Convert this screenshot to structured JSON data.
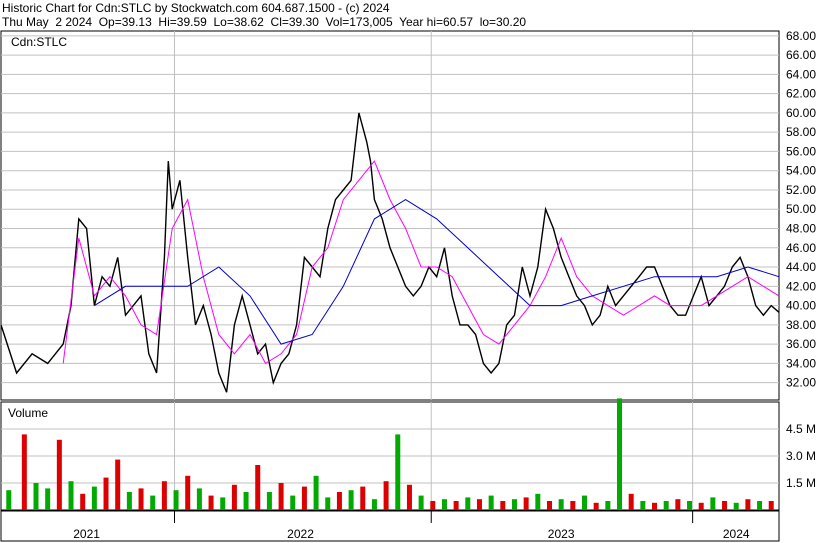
{
  "header": {
    "line1": "Historic Chart for Cdn:STLC by Stockwatch.com 604.687.1500 - (c) 2024",
    "line2": "Thu May  2 2024  Op=39.13  Hi=39.59  Lo=38.62  Cl=39.30  Vol=173,005  Year hi=60.57  lo=30.20"
  },
  "colors": {
    "price": "#000000",
    "ma_short": "#ff00ff",
    "ma_long": "#0000cc",
    "volume_up": "#00aa00",
    "volume_down": "#dd0000",
    "grid": "#c0c0c0"
  },
  "chart_data": [
    {
      "type": "line",
      "title": "Cdn:STLC",
      "ylim": [
        30.2,
        68.5
      ],
      "y_ticks": [
        "68.00",
        "66.00",
        "64.00",
        "62.00",
        "60.00",
        "58.00",
        "56.00",
        "54.00",
        "52.00",
        "50.00",
        "48.00",
        "46.00",
        "44.00",
        "42.00",
        "40.00",
        "38.00",
        "36.00",
        "34.00",
        "32.00"
      ],
      "x_labels": [
        "2021",
        "2022",
        "2023",
        "2024"
      ],
      "series": [
        {
          "role": "price",
          "x": [
            0.0,
            0.02,
            0.04,
            0.06,
            0.08,
            0.09,
            0.1,
            0.11,
            0.12,
            0.13,
            0.14,
            0.15,
            0.16,
            0.17,
            0.18,
            0.19,
            0.2,
            0.21,
            0.215,
            0.22,
            0.23,
            0.24,
            0.25,
            0.26,
            0.27,
            0.28,
            0.29,
            0.3,
            0.31,
            0.32,
            0.33,
            0.34,
            0.35,
            0.36,
            0.37,
            0.38,
            0.39,
            0.4,
            0.41,
            0.42,
            0.43,
            0.44,
            0.45,
            0.46,
            0.47,
            0.475,
            0.48,
            0.49,
            0.5,
            0.51,
            0.52,
            0.53,
            0.54,
            0.55,
            0.56,
            0.57,
            0.58,
            0.59,
            0.6,
            0.61,
            0.62,
            0.63,
            0.64,
            0.65,
            0.66,
            0.67,
            0.68,
            0.69,
            0.7,
            0.71,
            0.72,
            0.73,
            0.74,
            0.75,
            0.76,
            0.77,
            0.78,
            0.79,
            0.8,
            0.81,
            0.82,
            0.83,
            0.84,
            0.85,
            0.86,
            0.87,
            0.88,
            0.89,
            0.9,
            0.91,
            0.92,
            0.93,
            0.94,
            0.95,
            0.96,
            0.97,
            0.98,
            0.99,
            1.0
          ],
          "y": [
            38,
            33,
            35,
            34,
            36,
            40,
            49,
            48,
            40,
            43,
            42,
            45,
            39,
            40,
            41,
            35,
            33,
            45,
            55,
            50,
            53,
            45,
            38,
            40,
            37,
            33,
            31,
            38,
            41,
            38,
            35,
            36,
            32,
            34,
            35,
            38,
            45,
            44,
            43,
            48,
            51,
            52,
            53,
            60,
            57,
            55,
            51,
            49,
            46,
            44,
            42,
            41,
            42,
            44,
            43,
            46,
            41,
            38,
            38,
            37,
            34,
            33,
            34,
            38,
            39,
            44,
            41,
            44,
            50,
            48,
            45,
            43,
            41,
            40,
            38,
            39,
            42,
            40,
            41,
            42,
            43,
            44,
            44,
            42,
            40,
            39,
            39,
            41,
            43,
            40,
            41,
            42,
            44,
            45,
            43,
            40,
            39,
            40,
            39.3
          ]
        },
        {
          "role": "ma_short",
          "x": [
            0.08,
            0.1,
            0.12,
            0.14,
            0.16,
            0.18,
            0.2,
            0.22,
            0.24,
            0.26,
            0.28,
            0.3,
            0.32,
            0.34,
            0.36,
            0.38,
            0.4,
            0.42,
            0.44,
            0.46,
            0.48,
            0.5,
            0.52,
            0.54,
            0.56,
            0.58,
            0.6,
            0.62,
            0.64,
            0.66,
            0.68,
            0.7,
            0.72,
            0.74,
            0.76,
            0.78,
            0.8,
            0.82,
            0.84,
            0.86,
            0.88,
            0.9,
            0.92,
            0.94,
            0.96,
            0.98,
            1.0
          ],
          "y": [
            34,
            47,
            41,
            43,
            41,
            38,
            37,
            48,
            51,
            43,
            37,
            35,
            37,
            34,
            35,
            37,
            44,
            46,
            51,
            53,
            55,
            51,
            48,
            44,
            44,
            43,
            40,
            37,
            36,
            38,
            40,
            43,
            47,
            43,
            41,
            40,
            39,
            40,
            41,
            40,
            40,
            40,
            41,
            42,
            43,
            42,
            41
          ]
        },
        {
          "role": "ma_long",
          "x": [
            0.12,
            0.16,
            0.2,
            0.24,
            0.28,
            0.32,
            0.36,
            0.4,
            0.44,
            0.48,
            0.52,
            0.56,
            0.6,
            0.64,
            0.68,
            0.72,
            0.76,
            0.8,
            0.84,
            0.88,
            0.92,
            0.96,
            1.0
          ],
          "y": [
            40,
            42,
            42,
            42,
            44,
            41,
            36,
            37,
            42,
            49,
            51,
            49,
            46,
            43,
            40,
            40,
            41,
            42,
            43,
            43,
            43,
            44,
            43
          ]
        }
      ]
    },
    {
      "type": "bar",
      "title": "Volume",
      "ylim": [
        0,
        6.0
      ],
      "y_ticks": [
        "4.5 M",
        "3.0 M",
        "1.5 M"
      ],
      "bars_x": [
        0.01,
        0.03,
        0.045,
        0.06,
        0.075,
        0.09,
        0.105,
        0.12,
        0.135,
        0.15,
        0.165,
        0.18,
        0.195,
        0.21,
        0.225,
        0.24,
        0.255,
        0.27,
        0.285,
        0.3,
        0.315,
        0.33,
        0.345,
        0.36,
        0.375,
        0.39,
        0.405,
        0.42,
        0.435,
        0.45,
        0.465,
        0.48,
        0.495,
        0.51,
        0.525,
        0.54,
        0.555,
        0.57,
        0.585,
        0.6,
        0.615,
        0.63,
        0.645,
        0.66,
        0.675,
        0.69,
        0.705,
        0.72,
        0.735,
        0.75,
        0.765,
        0.78,
        0.795,
        0.81,
        0.825,
        0.84,
        0.855,
        0.87,
        0.885,
        0.9,
        0.915,
        0.93,
        0.945,
        0.96,
        0.975,
        0.99
      ],
      "values": [
        1.1,
        4.2,
        1.5,
        1.2,
        3.9,
        1.6,
        0.9,
        1.3,
        1.8,
        2.8,
        1.0,
        1.2,
        0.8,
        1.6,
        1.1,
        1.9,
        1.2,
        0.8,
        0.7,
        1.4,
        1.0,
        2.5,
        1.0,
        1.5,
        0.8,
        1.3,
        1.9,
        0.7,
        1.0,
        1.1,
        1.3,
        0.6,
        1.6,
        4.2,
        1.4,
        0.8,
        0.5,
        0.6,
        0.5,
        0.7,
        0.6,
        0.8,
        0.5,
        0.6,
        0.7,
        0.9,
        0.5,
        0.6,
        0.5,
        0.8,
        0.4,
        0.5,
        6.2,
        0.9,
        0.5,
        0.4,
        0.5,
        0.6,
        0.5,
        0.4,
        0.7,
        0.5,
        0.4,
        0.6,
        0.5,
        0.5
      ],
      "up": [
        true,
        false,
        true,
        true,
        false,
        true,
        false,
        true,
        false,
        false,
        true,
        false,
        true,
        false,
        true,
        false,
        true,
        false,
        true,
        false,
        true,
        false,
        true,
        false,
        true,
        false,
        true,
        true,
        false,
        true,
        false,
        true,
        false,
        true,
        false,
        true,
        false,
        true,
        false,
        true,
        false,
        true,
        false,
        true,
        false,
        true,
        false,
        true,
        false,
        true,
        false,
        true,
        true,
        false,
        true,
        false,
        true,
        false,
        true,
        false,
        true,
        false,
        true,
        false,
        true,
        false
      ]
    }
  ]
}
